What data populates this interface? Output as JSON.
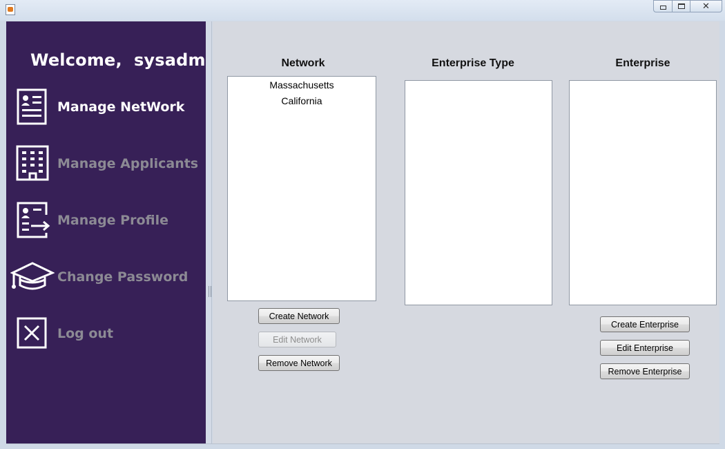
{
  "window": {
    "title": "",
    "controls": [
      "minimize",
      "maximize",
      "close"
    ]
  },
  "sidebar": {
    "welcome": "Welcome,  sysadmin",
    "items": [
      {
        "label": "Manage NetWork",
        "icon": "id-card-icon",
        "active": true
      },
      {
        "label": "Manage Applicants",
        "icon": "building-icon",
        "active": false
      },
      {
        "label": "Manage Profile",
        "icon": "profile-export-icon",
        "active": false
      },
      {
        "label": "Change Password",
        "icon": "graduation-cap-icon",
        "active": false
      },
      {
        "label": "Log out",
        "icon": "close-box-icon",
        "active": false
      }
    ]
  },
  "main": {
    "network": {
      "title": "Network",
      "items": [
        "Massachusetts",
        "California"
      ],
      "buttons": {
        "create": "Create Network",
        "edit": "Edit Network",
        "remove": "Remove Network"
      },
      "edit_enabled": false
    },
    "enterprise_type": {
      "title": "Enterprise Type",
      "items": []
    },
    "enterprise": {
      "title": "Enterprise",
      "items": [],
      "buttons": {
        "create": "Create Enterprise",
        "edit": "Edit Enterprise",
        "remove": "Remove Enterprise"
      }
    }
  },
  "colors": {
    "sidebar_bg": "#372057",
    "active_text": "#ffffff",
    "inactive_text": "#8c8a94",
    "content_bg": "#d6d9e0"
  }
}
